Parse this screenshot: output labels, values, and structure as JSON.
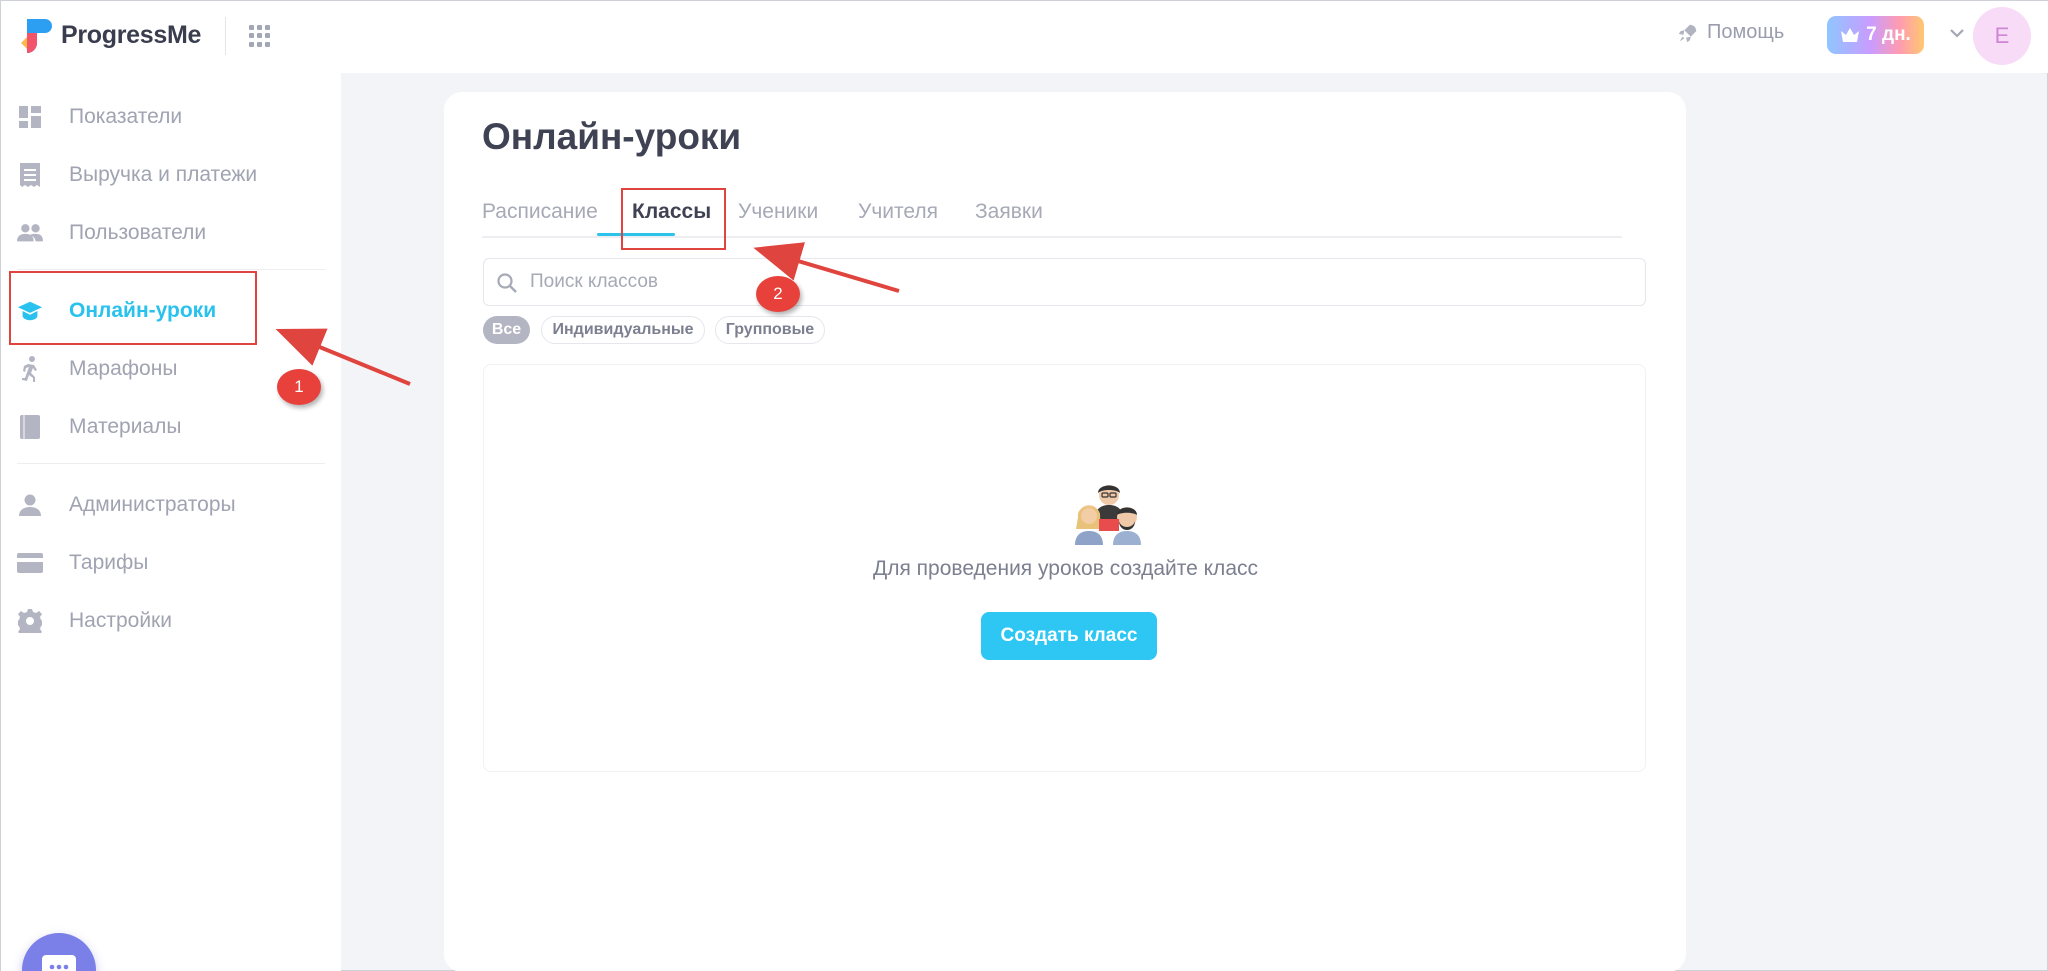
{
  "header": {
    "brand": "ProgressMe",
    "help_label": "Помощь",
    "trial_label": "7 дн.",
    "avatar_letter": "E"
  },
  "sidebar": {
    "items": [
      {
        "label": "Показатели",
        "icon": "dashboard-icon"
      },
      {
        "label": "Выручка и платежи",
        "icon": "receipt-icon"
      },
      {
        "label": "Пользователи",
        "icon": "users-icon"
      },
      {
        "label": "Онлайн-уроки",
        "icon": "graduation-cap-icon",
        "active": true
      },
      {
        "label": "Марафоны",
        "icon": "running-icon"
      },
      {
        "label": "Материалы",
        "icon": "book-icon"
      },
      {
        "label": "Администраторы",
        "icon": "person-icon"
      },
      {
        "label": "Тарифы",
        "icon": "credit-card-icon"
      },
      {
        "label": "Настройки",
        "icon": "gear-icon"
      }
    ]
  },
  "main": {
    "title": "Онлайн-уроки",
    "tabs": [
      {
        "label": "Расписание"
      },
      {
        "label": "Классы",
        "active": true
      },
      {
        "label": "Ученики"
      },
      {
        "label": "Учителя"
      },
      {
        "label": "Заявки"
      }
    ],
    "search": {
      "placeholder": "Поиск классов",
      "value": ""
    },
    "filters": [
      {
        "label": "Все",
        "selected": true
      },
      {
        "label": "Индивидуальные"
      },
      {
        "label": "Групповые"
      }
    ],
    "empty_state": {
      "message": "Для проведения уроков создайте класс",
      "button_label": "Создать класс"
    }
  },
  "annotations": [
    {
      "number": "1"
    },
    {
      "number": "2"
    }
  ],
  "colors": {
    "accent": "#29c2ee",
    "annotation": "#e0443e",
    "chat_button": "#7b7fe8"
  }
}
